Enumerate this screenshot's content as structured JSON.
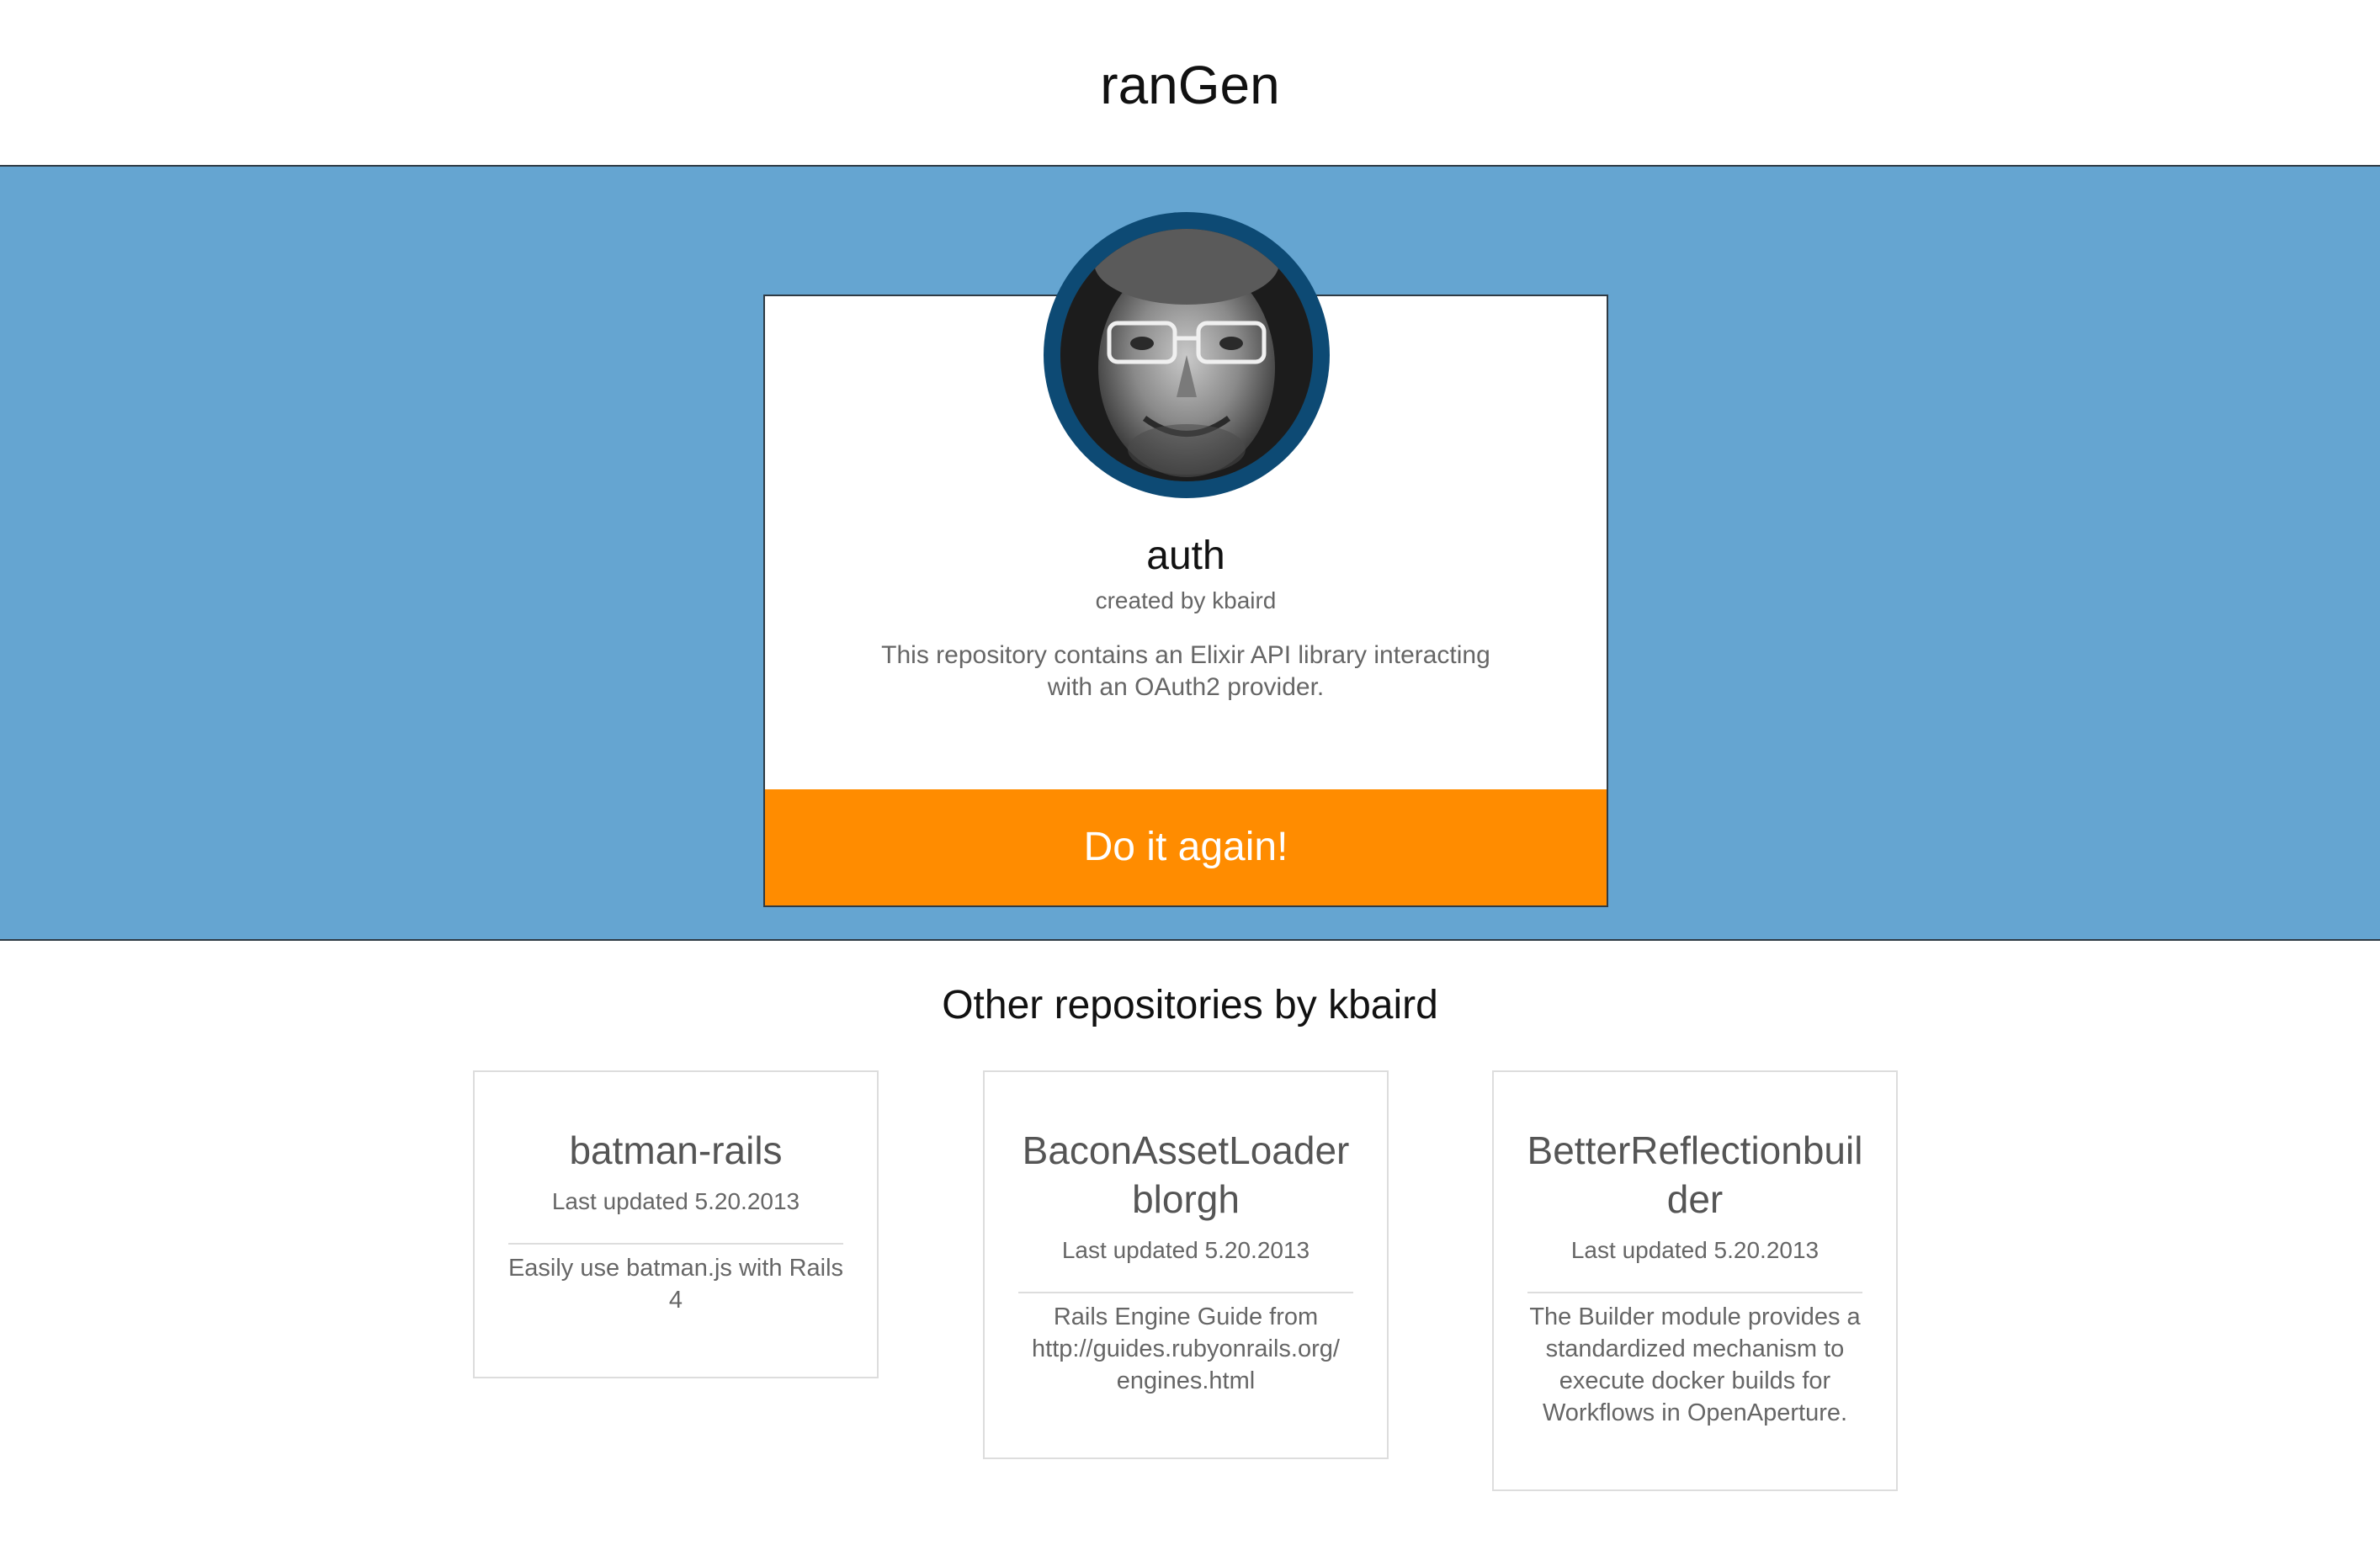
{
  "header": {
    "title": "ranGen"
  },
  "featured": {
    "repo_name": "auth",
    "author_line": "created by kbaird",
    "description": "This repository contains an Elixir API library interacting with an OAuth2 provider.",
    "button_label": "Do it again!"
  },
  "others": {
    "heading": "Other repositories by kbaird",
    "repos": [
      {
        "name": "batman-rails",
        "updated": "Last updated 5.20.2013",
        "description": "Easily use batman.js with Rails 4"
      },
      {
        "name": "BaconAssetLoader blorgh",
        "updated": "Last updated 5.20.2013",
        "description": "Rails Engine Guide from http://guides.rubyonrails.org/ engines.html"
      },
      {
        "name": "BetterReflectionbuilder",
        "updated": "Last updated 5.20.2013",
        "description": "The Builder module provides a standardized mechanism to execute docker builds for Workflows in OpenAperture."
      }
    ]
  },
  "colors": {
    "hero_background": "#65a5d1",
    "button_background": "#ff8c00",
    "avatar_ring": "#0d4a74"
  },
  "icons": {
    "avatar": "user-avatar-photo"
  }
}
